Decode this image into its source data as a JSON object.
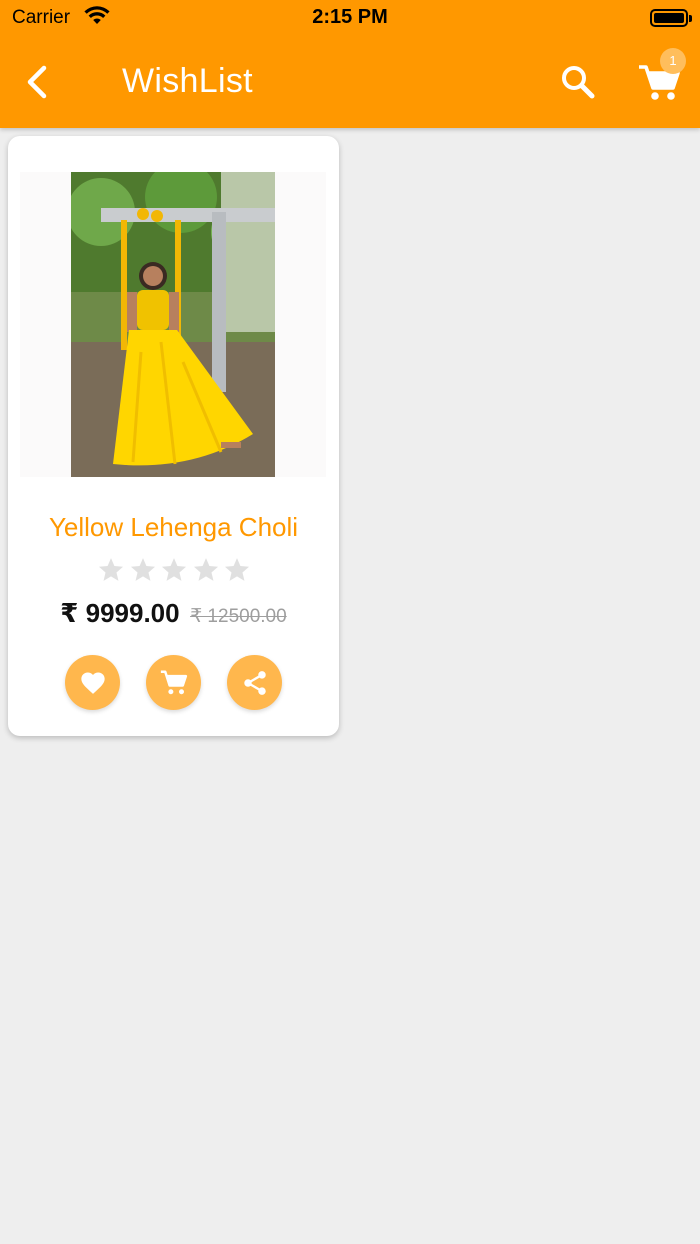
{
  "status_bar": {
    "carrier": "Carrier",
    "time": "2:15 PM"
  },
  "app_bar": {
    "title": "WishList",
    "cart_badge_count": "1",
    "icons": [
      "back-arrow-icon",
      "search-icon",
      "cart-icon"
    ]
  },
  "product": {
    "name": "Yellow Lehenga Choli",
    "rating": 0,
    "rating_max": 5,
    "price": "₹ 9999.00",
    "original_price": "₹ 12500.00",
    "actions": [
      "heart-icon",
      "add-to-cart-icon",
      "share-icon"
    ]
  },
  "colors": {
    "primary": "#ff9800",
    "action_button": "#ffb74d",
    "badge": "#ffbe5c",
    "background": "#eeeeee",
    "star_empty": "#e0e0e0"
  }
}
